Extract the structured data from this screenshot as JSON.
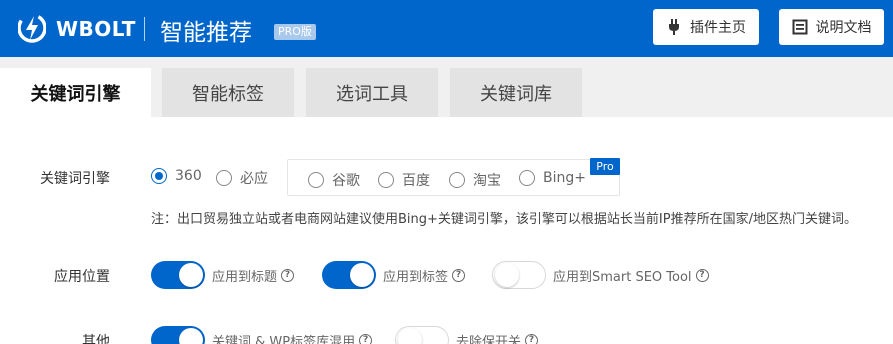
{
  "header": {
    "brand": "WBOLT",
    "title": "智能推荐",
    "pro_tag": "PRO版",
    "home_button": "插件主页",
    "docs_button": "说明文档",
    "bg_color": "#0066cc"
  },
  "tabs": [
    {
      "label": "关键词引擎",
      "active": true
    },
    {
      "label": "智能标签",
      "active": false
    },
    {
      "label": "选词工具",
      "active": false
    },
    {
      "label": "关键词库",
      "active": false
    }
  ],
  "engine": {
    "label": "关键词引擎",
    "options": [
      {
        "label": "360",
        "checked": true
      },
      {
        "label": "必应",
        "checked": false
      },
      {
        "label": "谷歌",
        "checked": false
      },
      {
        "label": "百度",
        "checked": false
      },
      {
        "label": "淘宝",
        "checked": false
      },
      {
        "label": "Bing+",
        "checked": false
      }
    ],
    "pro_badge": "Pro",
    "note": "注：出口贸易独立站或者电商网站建议使用Bing+关键词引擎，该引擎可以根据站长当前IP推荐所在国家/地区热门关键词。"
  },
  "apply": {
    "label": "应用位置",
    "toggles": [
      {
        "label": "应用到标题",
        "on": true
      },
      {
        "label": "应用到标签",
        "on": true
      },
      {
        "label": "应用到Smart SEO Tool",
        "on": false
      }
    ]
  },
  "other": {
    "label": "其他",
    "toggles": [
      {
        "label": "关键词 & WP标签库混用",
        "on": true
      },
      {
        "label": "去除保开关",
        "on": false
      }
    ]
  },
  "icons": {
    "logo": "lightning-bolt-logo-icon",
    "home": "plug-icon",
    "docs": "document-icon",
    "help": "question-circle-icon"
  }
}
